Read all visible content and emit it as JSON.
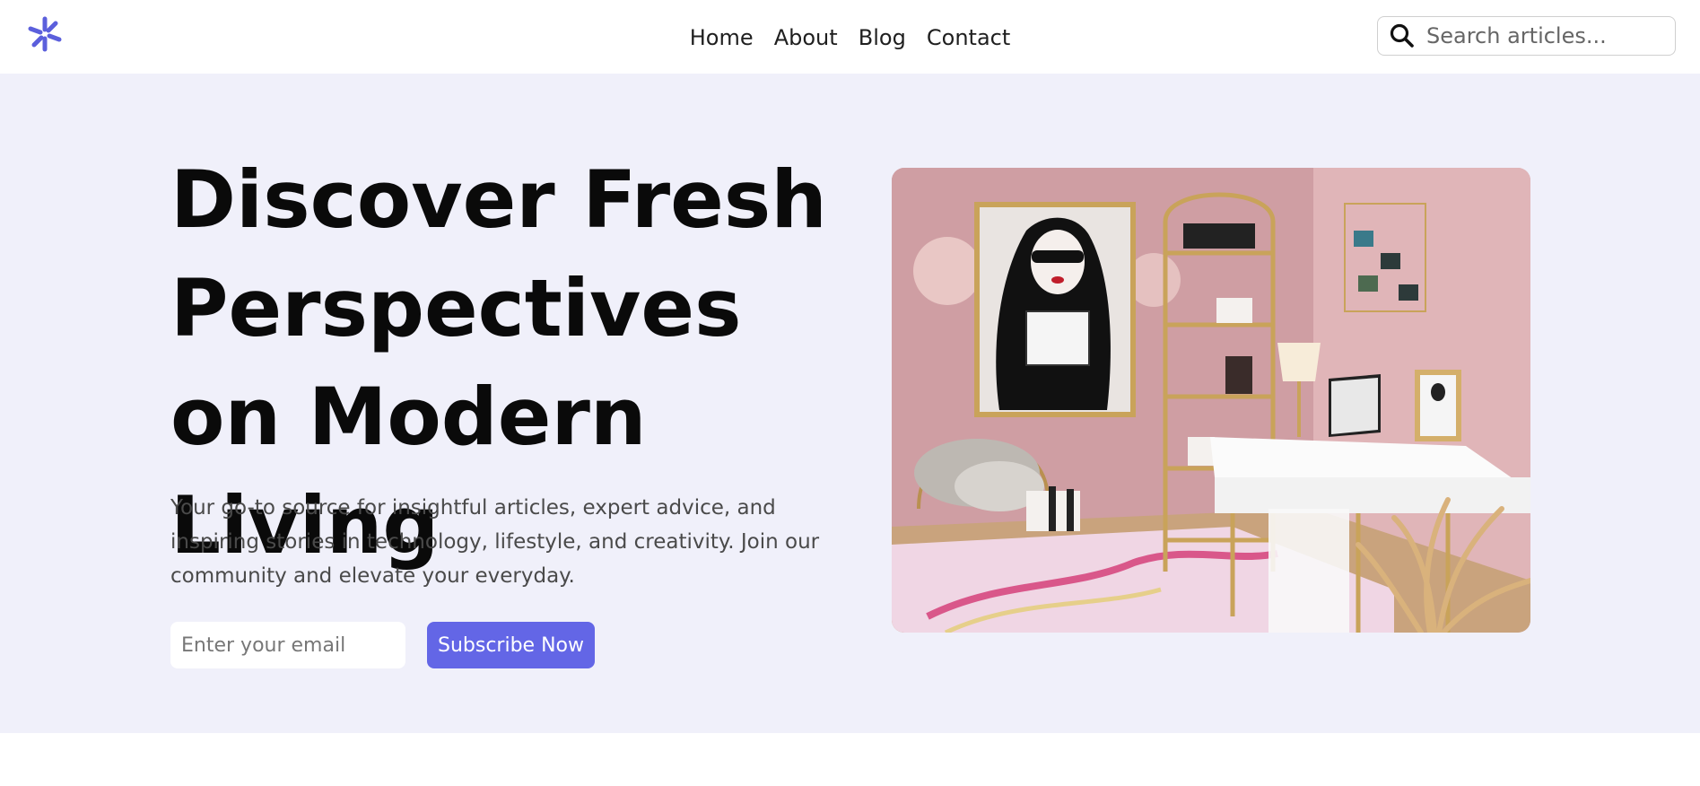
{
  "header": {
    "logo_icon": "asterisk-logo-icon",
    "nav": [
      {
        "label": "Home"
      },
      {
        "label": "About"
      },
      {
        "label": "Blog"
      },
      {
        "label": "Contact"
      }
    ],
    "search": {
      "icon": "search-icon",
      "placeholder": "Search articles..."
    }
  },
  "hero": {
    "title": "Discover Fresh Perspectives on Modern Living",
    "description": "Your go-to source for insightful articles, expert advice, and inspiring stories in technology, lifestyle, and creativity. Join our community and elevate your everyday.",
    "email_placeholder": "Enter your email",
    "subscribe_label": "Subscribe Now",
    "image_subject": "pink home office interior illustration"
  },
  "colors": {
    "accent": "#6366e6",
    "hero_background": "#f0f0fa",
    "title": "#0a0a0a",
    "text": "#4a4a4a"
  }
}
